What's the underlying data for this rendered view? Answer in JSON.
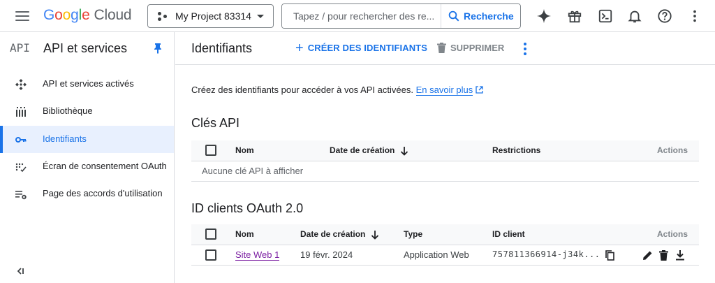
{
  "topbar": {
    "logo_google": "Google",
    "logo_cloud": "Cloud",
    "project_label": "My Project 83314",
    "search_placeholder": "Tapez / pour rechercher des re...",
    "search_button": "Recherche",
    "icons": [
      "menu-icon",
      "gemini-sparkle-icon",
      "gift-icon",
      "cloud-shell-icon",
      "bell-icon",
      "help-icon",
      "more-vert-icon"
    ]
  },
  "sidebar": {
    "badge": "API",
    "title": "API et services",
    "items": [
      {
        "label": "API et services activés",
        "icon": "enabled-apis-icon"
      },
      {
        "label": "Bibliothèque",
        "icon": "library-icon"
      },
      {
        "label": "Identifiants",
        "icon": "key-icon",
        "active": true
      },
      {
        "label": "Écran de consentement OAuth",
        "icon": "oauth-consent-icon"
      },
      {
        "label": "Page des accords d'utilisation",
        "icon": "agreements-icon"
      }
    ],
    "collapse_label": "<I"
  },
  "header": {
    "title": "Identifiants",
    "create_label": "CRÉER DES IDENTIFIANTS",
    "delete_label": "SUPPRIMER"
  },
  "intro": {
    "text": "Créez des identifiants pour accéder à vos API activées.",
    "link": "En savoir plus"
  },
  "api_keys": {
    "title": "Clés API",
    "columns": {
      "name": "Nom",
      "created": "Date de création",
      "restrictions": "Restrictions",
      "actions": "Actions"
    },
    "empty_text": "Aucune clé API à afficher"
  },
  "oauth": {
    "title": "ID clients OAuth 2.0",
    "columns": {
      "name": "Nom",
      "created": "Date de création",
      "type": "Type",
      "client_id": "ID client",
      "actions": "Actions"
    },
    "rows": [
      {
        "name": "Site Web 1",
        "created": "19 févr. 2024",
        "type": "Application Web",
        "client_id": "757811366914-j34k..."
      }
    ]
  },
  "colors": {
    "accent": "#1a73e8",
    "active_bg": "#e8f0fe",
    "border": "#dadce0",
    "link_visited": "#7b1fa2"
  }
}
